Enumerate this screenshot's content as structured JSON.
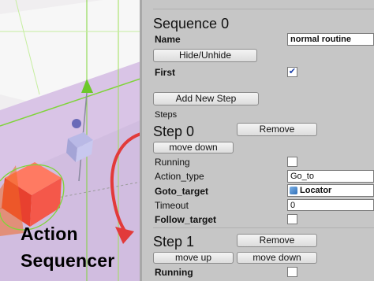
{
  "caption": {
    "line1": "Action",
    "line2": "Sequencer"
  },
  "inspector": {
    "sequence_title": "Sequence 0",
    "name_label": "Name",
    "name_value": "normal routine",
    "hide_unhide_label": "Hide/Unhide",
    "first_label": "First",
    "first_checked": "✔",
    "add_step_label": "Add New Step",
    "steps_label": "Steps",
    "step0": {
      "title": "Step 0",
      "remove_label": "Remove",
      "move_down_label": "move down",
      "running_label": "Running",
      "action_type_label": "Action_type",
      "action_type_value": "Go_to",
      "goto_target_label": "Goto_target",
      "goto_target_value": "Locator",
      "timeout_label": "Timeout",
      "timeout_value": "0",
      "follow_target_label": "Follow_target"
    },
    "step1": {
      "title": "Step 1",
      "remove_label": "Remove",
      "move_up_label": "move up",
      "move_down_label": "move down",
      "running_label": "Running"
    }
  },
  "colors": {
    "arrow": "#e23a3a",
    "cube": "#f0463c",
    "gizmo_green": "#7fd43a",
    "plane": "#d9c4e6"
  }
}
